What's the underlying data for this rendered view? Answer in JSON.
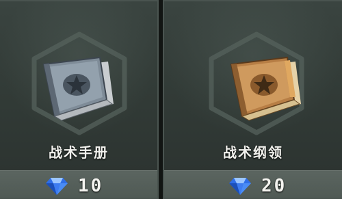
{
  "shop": {
    "items": [
      {
        "name": "战术手册",
        "price": "10",
        "currency_icon": "diamond-icon",
        "book_color": "#8e9ba6",
        "book_icon": "star-emblem-icon"
      },
      {
        "name": "战术纲领",
        "price": "20",
        "currency_icon": "diamond-icon",
        "book_color": "#c28a4e",
        "book_icon": "star-emblem-icon"
      }
    ]
  },
  "colors": {
    "panel": "#343d39",
    "price_bar": "#56605b",
    "gem": "#2e6ee8",
    "text": "#f2f2ee"
  }
}
